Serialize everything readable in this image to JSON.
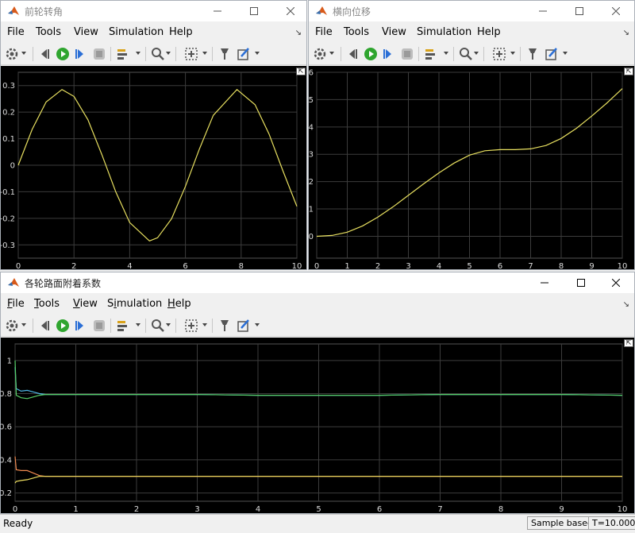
{
  "windows": [
    {
      "title": "前轮转角",
      "menu": [
        "File",
        "Tools",
        "View",
        "Simulation",
        "Help"
      ],
      "plot": {
        "xlim": [
          0,
          10
        ],
        "ylim": [
          -0.35,
          0.35
        ],
        "xticks": [
          "0",
          "2",
          "4",
          "6",
          "8",
          "10"
        ],
        "yticks": [
          "0.3",
          "0.2",
          "0.1",
          "0",
          "-0.1",
          "-0.2",
          "-0.3"
        ]
      }
    },
    {
      "title": "横向位移",
      "menu": [
        "File",
        "Tools",
        "View",
        "Simulation",
        "Help"
      ],
      "plot": {
        "xlim": [
          0,
          10
        ],
        "ylim": [
          -0.8,
          6
        ],
        "xticks": [
          "0",
          "1",
          "2",
          "3",
          "4",
          "5",
          "6",
          "7",
          "8",
          "9",
          "10"
        ],
        "yticks": [
          "6",
          "5",
          "4",
          "3",
          "2",
          "1",
          "0"
        ]
      }
    },
    {
      "title": "各轮路面附着系数",
      "menu": [
        "File",
        "Tools",
        "View",
        "Simulation",
        "Help"
      ],
      "plot": {
        "xlim": [
          0,
          10
        ],
        "ylim": [
          0.15,
          1.1
        ],
        "xticks": [
          "0",
          "1",
          "2",
          "3",
          "4",
          "5",
          "6",
          "7",
          "8",
          "9",
          "10"
        ],
        "yticks": [
          "1",
          "0.8",
          "0.6",
          "0.4",
          "0.2"
        ]
      }
    }
  ],
  "chart_data": [
    {
      "type": "line",
      "title": "前轮转角",
      "xlabel": "",
      "ylabel": "",
      "xlim": [
        0,
        10
      ],
      "ylim": [
        -0.35,
        0.35
      ],
      "grid": true,
      "series": [
        {
          "color": "#e8e060",
          "x": [
            0,
            0.5,
            1,
            1.57,
            2,
            2.5,
            3,
            3.5,
            4,
            4.71,
            5,
            5.5,
            6,
            6.5,
            7,
            7.85,
            8.5,
            9,
            9.5,
            10
          ],
          "y": [
            0,
            0.135,
            0.238,
            0.285,
            0.259,
            0.171,
            0.04,
            -0.1,
            -0.216,
            -0.285,
            -0.273,
            -0.202,
            -0.08,
            0.061,
            0.188,
            0.285,
            0.228,
            0.118,
            -0.021,
            -0.155
          ]
        }
      ]
    },
    {
      "type": "line",
      "title": "横向位移",
      "xlabel": "",
      "ylabel": "",
      "xlim": [
        0,
        10
      ],
      "ylim": [
        -0.8,
        6
      ],
      "grid": true,
      "series": [
        {
          "color": "#e8e060",
          "x": [
            0,
            0.5,
            1,
            1.5,
            2,
            2.5,
            3,
            3.5,
            4,
            4.5,
            5,
            5.5,
            6,
            6.5,
            7,
            7.5,
            8,
            8.5,
            9,
            9.5,
            10
          ],
          "y": [
            0,
            0.03,
            0.15,
            0.38,
            0.7,
            1.08,
            1.5,
            1.92,
            2.32,
            2.68,
            2.97,
            3.13,
            3.17,
            3.17,
            3.2,
            3.32,
            3.58,
            3.95,
            4.4,
            4.88,
            5.4
          ]
        }
      ]
    },
    {
      "type": "line",
      "title": "各轮路面附着系数",
      "xlabel": "",
      "ylabel": "",
      "xlim": [
        0,
        10
      ],
      "ylim": [
        0.15,
        1.1
      ],
      "grid": true,
      "series": [
        {
          "color": "#4fb8e8",
          "x": [
            0,
            0.02,
            0.1,
            0.2,
            0.3,
            0.4,
            0.5,
            1,
            2,
            3,
            4,
            5,
            6,
            7,
            8,
            9,
            10
          ],
          "y": [
            0.96,
            0.83,
            0.815,
            0.82,
            0.81,
            0.8,
            0.795,
            0.795,
            0.795,
            0.795,
            0.79,
            0.79,
            0.79,
            0.795,
            0.795,
            0.795,
            0.79
          ]
        },
        {
          "color": "#58d068",
          "x": [
            0,
            0.02,
            0.1,
            0.2,
            0.3,
            0.4,
            0.5,
            1,
            2,
            3,
            4,
            5,
            6,
            7,
            8,
            9,
            10
          ],
          "y": [
            1.0,
            0.79,
            0.775,
            0.77,
            0.78,
            0.79,
            0.795,
            0.795,
            0.795,
            0.795,
            0.79,
            0.79,
            0.79,
            0.795,
            0.795,
            0.795,
            0.79
          ]
        },
        {
          "color": "#f08a50",
          "x": [
            0,
            0.02,
            0.1,
            0.2,
            0.3,
            0.4,
            0.5,
            1,
            2,
            3,
            4,
            5,
            6,
            7,
            8,
            9,
            10
          ],
          "y": [
            0.42,
            0.34,
            0.335,
            0.335,
            0.32,
            0.305,
            0.3,
            0.3,
            0.3,
            0.3,
            0.3,
            0.3,
            0.3,
            0.3,
            0.3,
            0.3,
            0.3
          ]
        },
        {
          "color": "#f0e060",
          "x": [
            0,
            0.02,
            0.1,
            0.2,
            0.3,
            0.4,
            0.5,
            1,
            2,
            3,
            4,
            5,
            6,
            7,
            8,
            9,
            10
          ],
          "y": [
            0.26,
            0.27,
            0.275,
            0.28,
            0.29,
            0.3,
            0.3,
            0.3,
            0.3,
            0.3,
            0.3,
            0.3,
            0.3,
            0.3,
            0.3,
            0.3,
            0.3
          ]
        }
      ]
    }
  ],
  "status": {
    "ready": "Ready",
    "sample_mode": "Sample based",
    "time": "T=10.000"
  },
  "colors": {
    "plot_bg": "#000000",
    "grid": "#444444",
    "axis_text": "#e0e0e0"
  },
  "icons": [
    "configuration-icon",
    "step-back-icon",
    "run-icon",
    "step-forward-icon",
    "stop-icon",
    "highlight-icon",
    "zoom-icon",
    "autoscale-icon",
    "pin-icon",
    "style-icon"
  ]
}
